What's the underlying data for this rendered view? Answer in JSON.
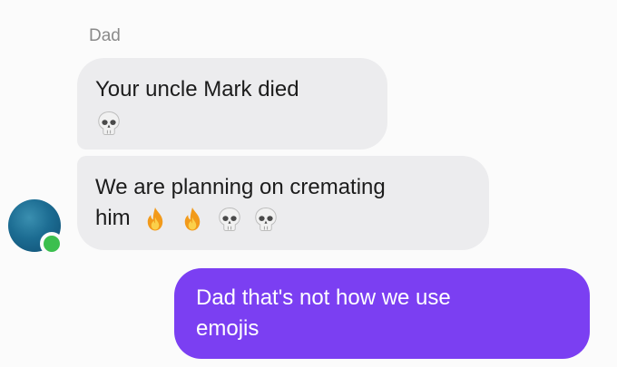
{
  "conversation": {
    "sender_name": "Dad",
    "messages": [
      {
        "direction": "incoming",
        "text": "Your uncle Mark died",
        "emojis": [
          "skull-emoji"
        ]
      },
      {
        "direction": "incoming",
        "text_line1": "We are planning on cremating",
        "text_line2": "him",
        "emojis": [
          "fire-emoji",
          "fire-emoji",
          "skull-emoji",
          "skull-emoji"
        ]
      },
      {
        "direction": "outgoing",
        "text_line1": "Dad that's not how we use",
        "text_line2": "emojis"
      }
    ]
  },
  "avatar": {
    "status": "online"
  },
  "colors": {
    "background": "#fbfbfb",
    "incoming_bubble": "#ececee",
    "outgoing_bubble": "#7b3ff2",
    "sender_name": "#8a8a8a",
    "online_status": "#3bbf4e",
    "avatar": "#1c6c92"
  }
}
